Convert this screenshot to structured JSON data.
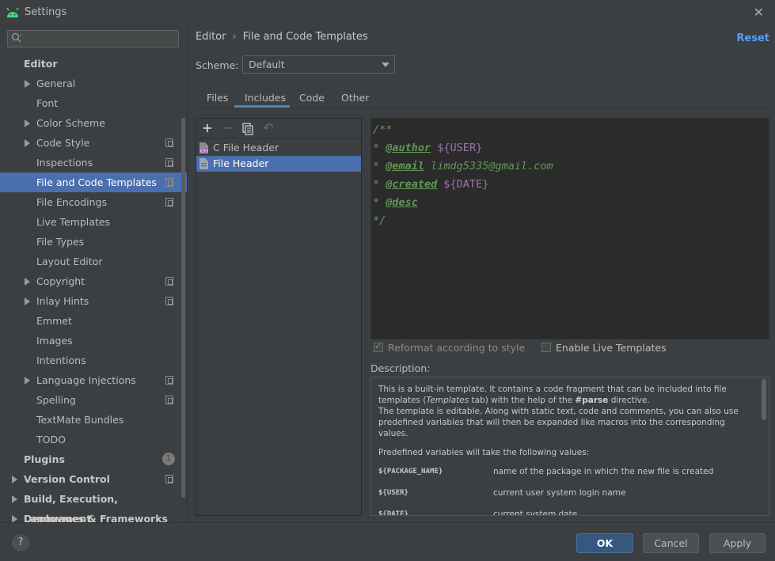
{
  "window": {
    "title": "Settings"
  },
  "sidebar": {
    "search_placeholder": "",
    "items": [
      {
        "label": "Editor",
        "bold": true,
        "arrow": false,
        "copy": false
      },
      {
        "label": "General",
        "bold": false,
        "arrow": true,
        "copy": false
      },
      {
        "label": "Font",
        "bold": false,
        "arrow": false,
        "copy": false
      },
      {
        "label": "Color Scheme",
        "bold": false,
        "arrow": true,
        "copy": false
      },
      {
        "label": "Code Style",
        "bold": false,
        "arrow": true,
        "copy": true
      },
      {
        "label": "Inspections",
        "bold": false,
        "arrow": false,
        "copy": true
      },
      {
        "label": "File and Code Templates",
        "bold": false,
        "arrow": false,
        "copy": true,
        "selected": true
      },
      {
        "label": "File Encodings",
        "bold": false,
        "arrow": false,
        "copy": true
      },
      {
        "label": "Live Templates",
        "bold": false,
        "arrow": false,
        "copy": false
      },
      {
        "label": "File Types",
        "bold": false,
        "arrow": false,
        "copy": false
      },
      {
        "label": "Layout Editor",
        "bold": false,
        "arrow": false,
        "copy": false
      },
      {
        "label": "Copyright",
        "bold": false,
        "arrow": true,
        "copy": true
      },
      {
        "label": "Inlay Hints",
        "bold": false,
        "arrow": true,
        "copy": true
      },
      {
        "label": "Emmet",
        "bold": false,
        "arrow": false,
        "copy": false
      },
      {
        "label": "Images",
        "bold": false,
        "arrow": false,
        "copy": false
      },
      {
        "label": "Intentions",
        "bold": false,
        "arrow": false,
        "copy": false
      },
      {
        "label": "Language Injections",
        "bold": false,
        "arrow": true,
        "copy": true
      },
      {
        "label": "Spelling",
        "bold": false,
        "arrow": false,
        "copy": true
      },
      {
        "label": "TextMate Bundles",
        "bold": false,
        "arrow": false,
        "copy": false
      },
      {
        "label": "TODO",
        "bold": false,
        "arrow": false,
        "copy": false
      },
      {
        "label": "Plugins",
        "bold": true,
        "arrow": false,
        "copy": false,
        "badge": "1"
      },
      {
        "label": "Version Control",
        "bold": true,
        "arrow": true,
        "copy": true
      },
      {
        "label": "Build, Execution, Deployment",
        "bold": true,
        "arrow": true,
        "copy": false
      },
      {
        "label": "Languages & Frameworks",
        "bold": true,
        "arrow": true,
        "copy": false
      }
    ]
  },
  "header": {
    "breadcrumb_root": "Editor",
    "breadcrumb_page": "File and Code Templates",
    "reset_label": "Reset"
  },
  "scheme": {
    "label": "Scheme:",
    "value": "Default"
  },
  "tabs": [
    "Files",
    "Includes",
    "Code",
    "Other"
  ],
  "active_tab": "Includes",
  "templates": [
    {
      "label": "C File Header",
      "icon": "c-file-icon",
      "selected": false
    },
    {
      "label": "File Header",
      "icon": "file-icon",
      "selected": true
    }
  ],
  "editor": {
    "lines": [
      {
        "prefix": "/**",
        "tag": "",
        "rest": "",
        "rest_kind": ""
      },
      {
        "prefix": "* ",
        "tag": "@author",
        "rest": " ${USER}",
        "rest_kind": "var"
      },
      {
        "prefix": "* ",
        "tag": "@email",
        "rest": " limdg5335@gmail.com",
        "rest_kind": "mail"
      },
      {
        "prefix": "* ",
        "tag": "@created",
        "rest": " ${DATE}",
        "rest_kind": "var"
      },
      {
        "prefix": "* ",
        "tag": "@desc",
        "rest": "",
        "rest_kind": ""
      },
      {
        "prefix": "*/",
        "tag": "",
        "rest": "",
        "rest_kind": ""
      }
    ]
  },
  "options": {
    "reformat_label": "Reformat according to style",
    "reformat_checked": true,
    "live_templates_label": "Enable Live Templates",
    "live_templates_checked": false
  },
  "description": {
    "label": "Description:",
    "p1_a": "This is a built-in template. It contains a code fragment that can be included into file templates (",
    "p1_em": "Templates",
    "p1_b": " tab) with the help of the ",
    "p1_bold": "#parse",
    "p1_c": " directive.",
    "p2": "The template is editable. Along with static text, code and comments, you can also use predefined variables that will then be expanded like macros into the corresponding values.",
    "p3": "Predefined variables will take the following values:",
    "vars": [
      {
        "name": "${PACKAGE_NAME}",
        "desc": "name of the package in which the new file is created"
      },
      {
        "name": "${USER}",
        "desc": "current user system login name"
      },
      {
        "name": "${DATE}",
        "desc": "current system date"
      }
    ]
  },
  "footer": {
    "help_label": "?",
    "ok_label": "OK",
    "cancel_label": "Cancel",
    "apply_label": "Apply"
  }
}
